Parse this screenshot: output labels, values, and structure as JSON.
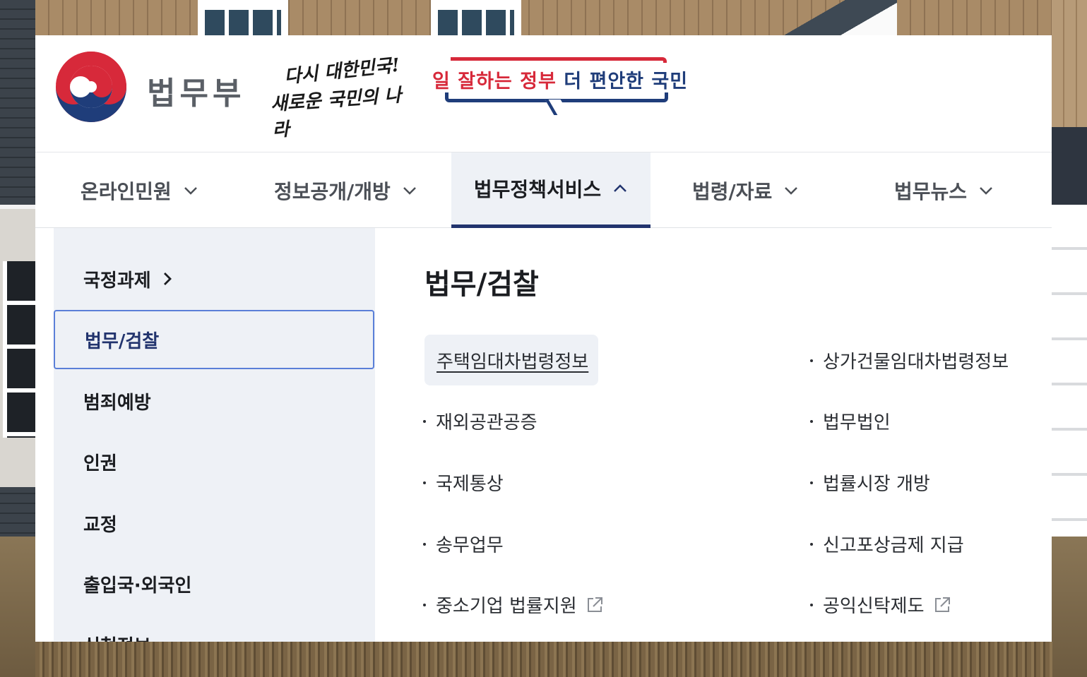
{
  "header": {
    "ministry_name": "법무부",
    "slogan_line1": "다시 대한민국!",
    "slogan_line2": "새로운 국민의 나라",
    "govt_slogan_red": "일 잘하는 정부",
    "govt_slogan_blue": "더 편안한 국민"
  },
  "nav": {
    "items": [
      {
        "label": "온라인민원"
      },
      {
        "label": "정보공개/개방"
      },
      {
        "label": "법무정책서비스",
        "active": true
      },
      {
        "label": "법령/자료"
      },
      {
        "label": "법무뉴스"
      }
    ]
  },
  "sidebar": {
    "items": [
      {
        "label": "국정과제"
      },
      {
        "label": "법무/검찰",
        "selected": true
      },
      {
        "label": "범죄예방"
      },
      {
        "label": "인권"
      },
      {
        "label": "교정"
      },
      {
        "label": "출입국·외국인"
      },
      {
        "label": "신청정보"
      }
    ]
  },
  "content": {
    "title": "법무/검찰",
    "links": [
      {
        "label": "주택임대차법령정보",
        "external": false
      },
      {
        "label": "상가건물임대차법령정보",
        "external": false
      },
      {
        "label": "재외공관공증",
        "external": false
      },
      {
        "label": "법무법인",
        "external": false
      },
      {
        "label": "국제통상",
        "external": false
      },
      {
        "label": "법률시장 개방",
        "external": false
      },
      {
        "label": "송무업무",
        "external": false
      },
      {
        "label": "신고포상금제 지급",
        "external": false
      },
      {
        "label": "중소기업 법률지원",
        "external": true
      },
      {
        "label": "공익신탁제도",
        "external": true
      }
    ]
  },
  "colors": {
    "emblem_red": "#d7293a",
    "emblem_blue": "#1f3d7a",
    "active_underline": "#22346e",
    "selected_border": "#5a7fd8",
    "submenu_bg": "#eef1f6"
  }
}
